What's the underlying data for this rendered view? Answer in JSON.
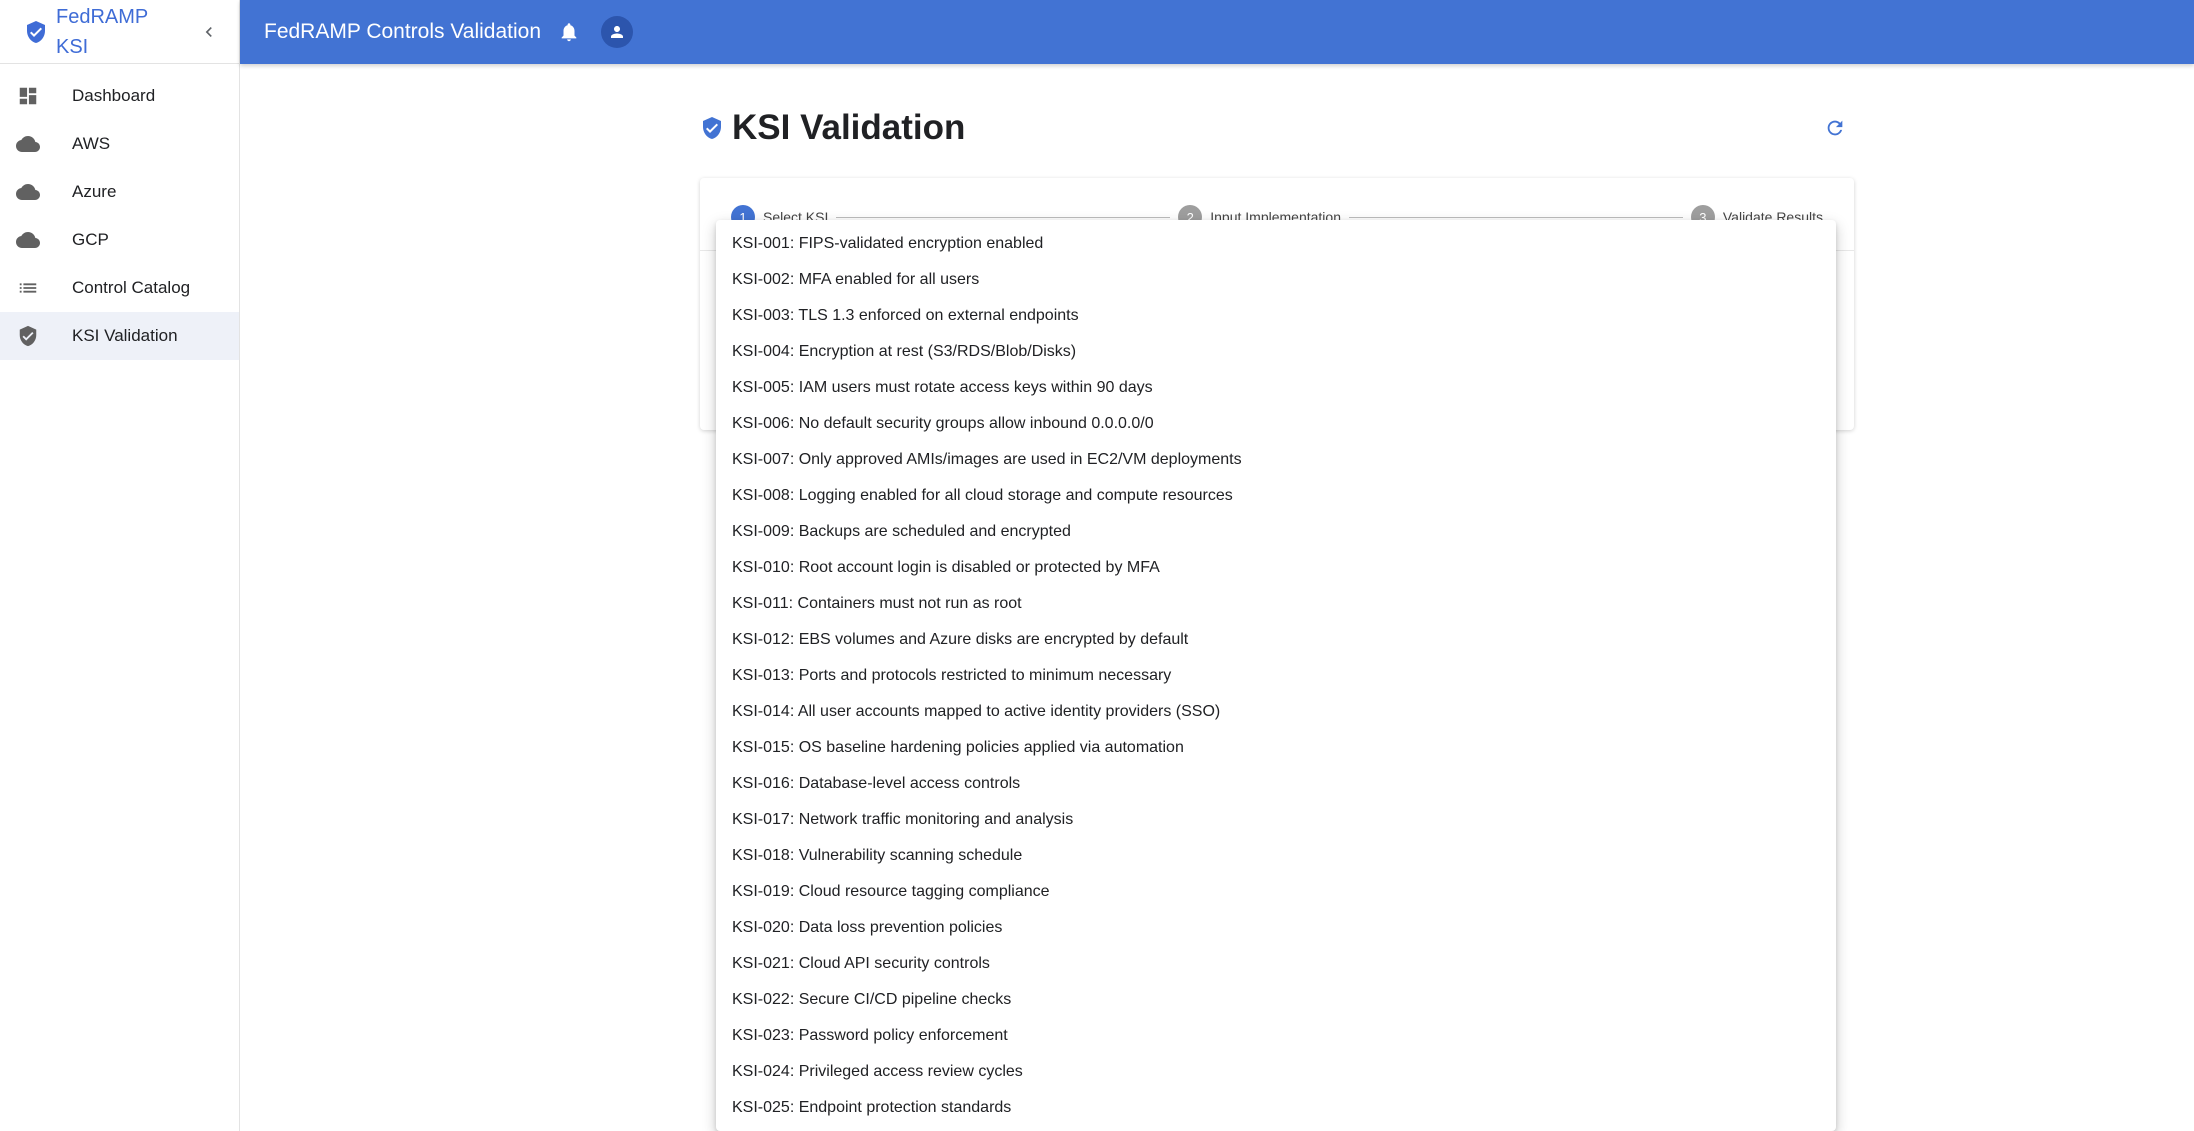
{
  "sidebar": {
    "brand": "FedRAMP KSI",
    "items": [
      {
        "label": "Dashboard",
        "icon": "dashboard-icon"
      },
      {
        "label": "AWS",
        "icon": "cloud-icon"
      },
      {
        "label": "Azure",
        "icon": "cloud-icon"
      },
      {
        "label": "GCP",
        "icon": "cloud-icon"
      },
      {
        "label": "Control Catalog",
        "icon": "list-icon"
      },
      {
        "label": "KSI Validation",
        "icon": "verified-shield-icon",
        "active": true
      }
    ]
  },
  "topbar": {
    "title": "FedRAMP Controls Validation"
  },
  "page": {
    "title": "KSI Validation"
  },
  "stepper": {
    "steps": [
      {
        "number": "1",
        "label": "Select KSI",
        "state": "active"
      },
      {
        "number": "2",
        "label": "Input Implementation",
        "state": "pending"
      },
      {
        "number": "3",
        "label": "Validate Results",
        "state": "pending"
      }
    ]
  },
  "dropdown": {
    "options": [
      "KSI-001: FIPS-validated encryption enabled",
      "KSI-002: MFA enabled for all users",
      "KSI-003: TLS 1.3 enforced on external endpoints",
      "KSI-004: Encryption at rest (S3/RDS/Blob/Disks)",
      "KSI-005: IAM users must rotate access keys within 90 days",
      "KSI-006: No default security groups allow inbound 0.0.0.0/0",
      "KSI-007: Only approved AMIs/images are used in EC2/VM deployments",
      "KSI-008: Logging enabled for all cloud storage and compute resources",
      "KSI-009: Backups are scheduled and encrypted",
      "KSI-010: Root account login is disabled or protected by MFA",
      "KSI-011: Containers must not run as root",
      "KSI-012: EBS volumes and Azure disks are encrypted by default",
      "KSI-013: Ports and protocols restricted to minimum necessary",
      "KSI-014: All user accounts mapped to active identity providers (SSO)",
      "KSI-015: OS baseline hardening policies applied via automation",
      "KSI-016: Database-level access controls",
      "KSI-017: Network traffic monitoring and analysis",
      "KSI-018: Vulnerability scanning schedule",
      "KSI-019: Cloud resource tagging compliance",
      "KSI-020: Data loss prevention policies",
      "KSI-021: Cloud API security controls",
      "KSI-022: Secure CI/CD pipeline checks",
      "KSI-023: Password policy enforcement",
      "KSI-024: Privileged access review cycles",
      "KSI-025: Endpoint protection standards"
    ]
  },
  "colors": {
    "primary": "#4273d3",
    "brand_text": "#3f6cd6",
    "active_nav_bg": "#eef1f8",
    "icon_gray": "#616161"
  }
}
